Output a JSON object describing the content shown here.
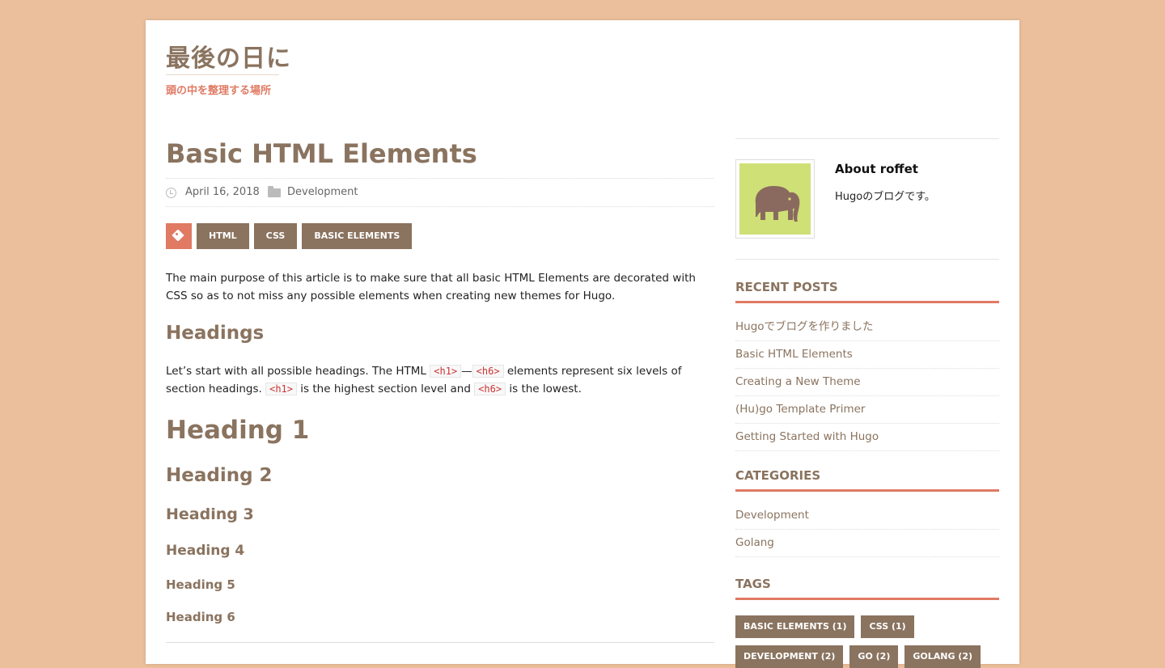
{
  "site": {
    "title": "最後の日に",
    "tagline": "頭の中を整理する場所"
  },
  "post": {
    "title": "Basic HTML Elements",
    "date": "April 16, 2018",
    "category": "Development",
    "tags": [
      "HTML",
      "CSS",
      "BASIC ELEMENTS"
    ],
    "intro": "The main purpose of this article is to make sure that all basic HTML Elements are decorated with CSS so as to not miss any possible elements when creating new themes for Hugo.",
    "headings_title": "Headings",
    "para2": {
      "t1": "Let’s start with all possible headings. The HTML ",
      "c1": "<h1>",
      "dash": "—",
      "c2": "<h6>",
      "t2": " elements represent six levels of section headings. ",
      "c3": "<h1>",
      "t3": " is the highest section level and ",
      "c4": "<h6>",
      "t4": " is the lowest."
    },
    "h1": "Heading 1",
    "h2": "Heading 2",
    "h3": "Heading 3",
    "h4": "Heading 4",
    "h5": "Heading 5",
    "h6": "Heading 6"
  },
  "sidebar": {
    "about": {
      "title": "About roffet",
      "text": "Hugoのブログです。"
    },
    "recent": {
      "title": "RECENT POSTS",
      "items": [
        "Hugoでブログを作りました",
        "Basic HTML Elements",
        "Creating a New Theme",
        "(Hu)go Template Primer",
        "Getting Started with Hugo"
      ]
    },
    "categories": {
      "title": "CATEGORIES",
      "items": [
        "Development",
        "Golang"
      ]
    },
    "tags": {
      "title": "TAGS",
      "items": [
        "BASIC ELEMENTS (1)",
        "CSS (1)",
        "DEVELOPMENT (2)",
        "GO (2)",
        "GOLANG (2)"
      ]
    }
  },
  "colors": {
    "background": "#ebbf9c",
    "accent": "#e07a63",
    "brown": "#8a735f",
    "avatar_bg": "#cfe077"
  }
}
